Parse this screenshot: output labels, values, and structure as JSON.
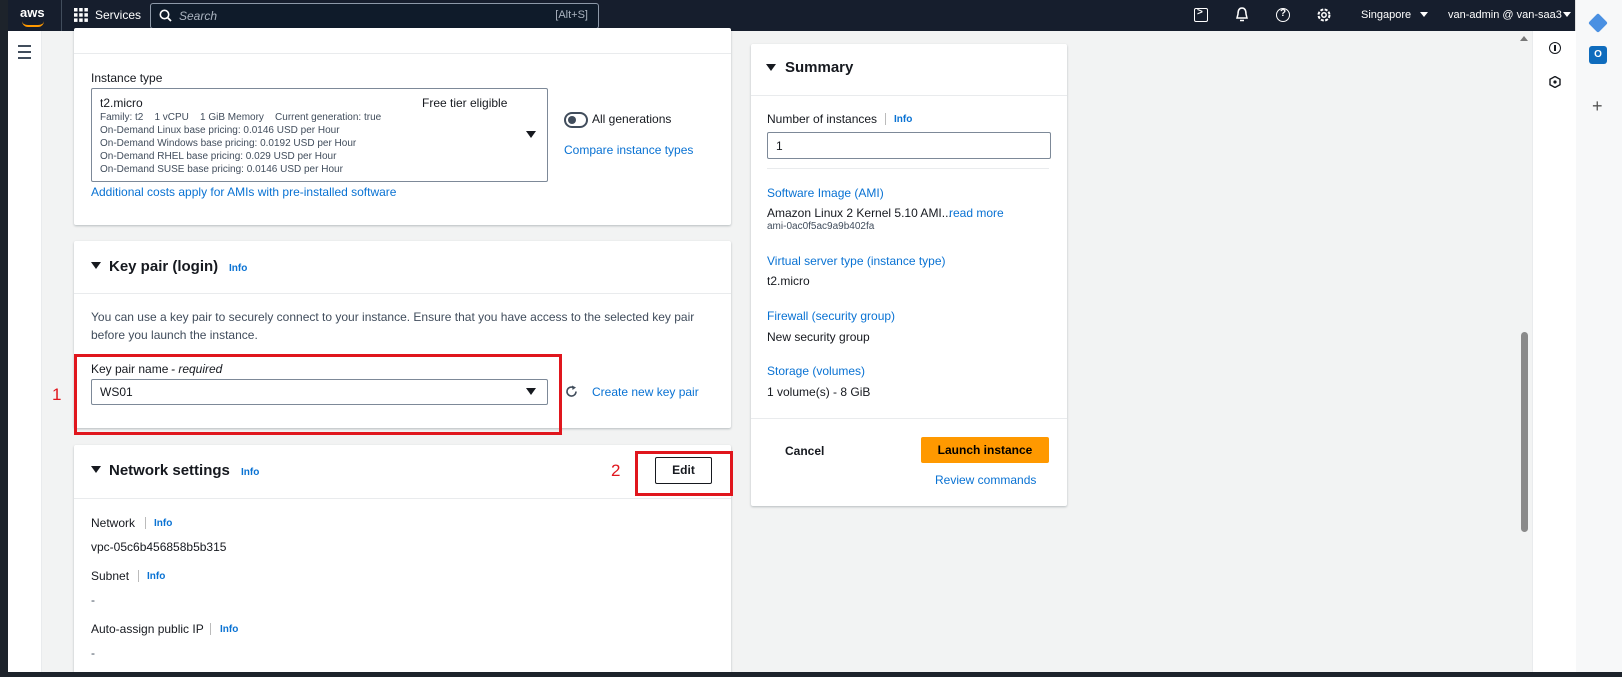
{
  "topnav": {
    "logo": "aws",
    "services_label": "Services",
    "search_placeholder": "Search",
    "search_shortcut": "[Alt+S]",
    "region": "Singapore",
    "account": "van-admin @ van-saa3"
  },
  "instance_type": {
    "label": "Instance type",
    "selected": "t2.micro",
    "free_tier": "Free tier eligible",
    "details": [
      "Family: t2    1 vCPU    1 GiB Memory    Current generation: true",
      "On-Demand Linux base pricing: 0.0146 USD per Hour",
      "On-Demand Windows base pricing: 0.0192 USD per Hour",
      "On-Demand RHEL base pricing: 0.029 USD per Hour",
      "On-Demand SUSE base pricing: 0.0146 USD per Hour"
    ],
    "all_generations": "All generations",
    "compare_link": "Compare instance types",
    "additional_costs_link": "Additional costs apply for AMIs with pre-installed software"
  },
  "key_pair": {
    "title": "Key pair (login)",
    "info": "Info",
    "description_line1": "You can use a key pair to securely connect to your instance. Ensure that you have access to the selected key pair",
    "description_line2": "before you launch the instance.",
    "name_label": "Key pair name",
    "required": "- required",
    "selected": "WS01",
    "create_link": "Create new key pair"
  },
  "network": {
    "title": "Network settings",
    "info": "Info",
    "edit_label": "Edit",
    "network_label": "Network",
    "network_value": "vpc-05c6b456858b5b315",
    "subnet_label": "Subnet",
    "subnet_value": "-",
    "public_ip_label": "Auto-assign public IP",
    "public_ip_value": "-"
  },
  "annotations": {
    "one": "1",
    "two": "2"
  },
  "summary": {
    "title": "Summary",
    "num_instances_label": "Number of instances",
    "info": "Info",
    "num_instances_value": "1",
    "ami_label": "Software Image (AMI)",
    "ami_value": "Amazon Linux 2 Kernel 5.10 AMI...",
    "read_more": "read more",
    "ami_id": "ami-0ac0f5ac9a9b402fa",
    "server_type_label": "Virtual server type (instance type)",
    "server_type_value": "t2.micro",
    "firewall_label": "Firewall (security group)",
    "firewall_value": "New security group",
    "storage_label": "Storage (volumes)",
    "storage_value": "1 volume(s) - 8 GiB",
    "cancel_label": "Cancel",
    "launch_label": "Launch instance",
    "review_label": "Review commands"
  },
  "colors": {
    "nav_bg": "#161e2d",
    "link": "#0972d3",
    "launch": "#ff9900",
    "annotation": "#e0161d"
  }
}
